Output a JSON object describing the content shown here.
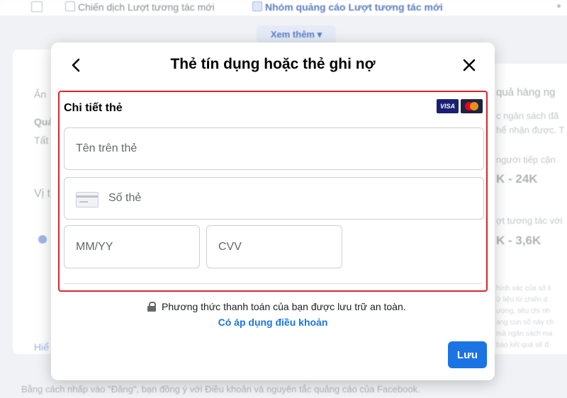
{
  "background": {
    "breadcrumb": [
      "Chiến dịch Lượt tương tác mới",
      "Nhóm quảng cáo Lượt tương tác mới"
    ],
    "see_more": "Xem thêm",
    "left_fragments": [
      "Ản",
      "Quả",
      "Tất",
      "Vị t",
      "Hiể"
    ],
    "right_fragments": {
      "header": "quả hàng ng",
      "budget_line1": "c ngân sách đã",
      "budget_line2": "hể nhận được. T",
      "reach_label": "người tiếp cận",
      "reach_value": "K - 24K",
      "engagement_label": "ợt tương tác với",
      "engagement_value": "K - 3,6K",
      "disclaimer": [
        "hính xác của số li",
        "ữ liệu từ chiến d",
        "ượng, tiêu chí nh",
        "ang con số này ch",
        "mà ngân sách ma",
        "bảo kết quả sẽ đ"
      ]
    },
    "footer": "Bằng cách nhấp vào \"Đăng\", bạn đồng ý với Điều khoản và nguyên tắc quảng cáo của Facebook."
  },
  "modal": {
    "title": "Thẻ tín dụng hoặc thẻ ghi nợ",
    "card_details_label": "Chi tiết thẻ",
    "visa_label": "VISA",
    "name_placeholder": "Tên trên thẻ",
    "number_placeholder": "Số thẻ",
    "expiry_placeholder": "MM/YY",
    "cvv_placeholder": "CVV",
    "secure_note": "Phương thức thanh toán của bạn được lưu trữ an toàn.",
    "terms_link": "Có áp dụng điều khoản",
    "save_label": "Lưu"
  },
  "colors": {
    "accent": "#1b74e4",
    "highlight_border": "#d7262f"
  }
}
